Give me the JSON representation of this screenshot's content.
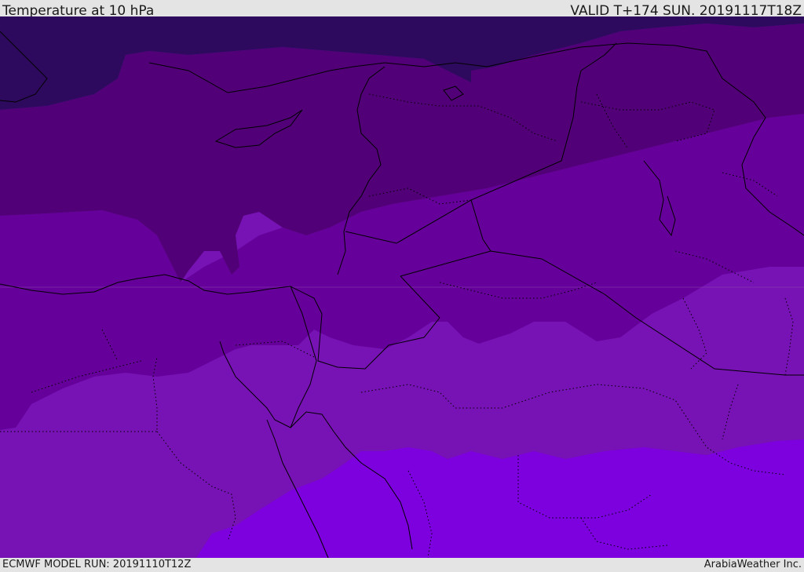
{
  "header": {
    "title": "Temperature at 10 hPa",
    "valid": "VALID T+174 SUN. 20191117T18Z"
  },
  "footer": {
    "model_run": "ECMWF MODEL RUN: 20191110T12Z",
    "credit": "ArabiaWeather Inc."
  },
  "map": {
    "field_colors": [
      "#2e0a5e",
      "#520078",
      "#66009a",
      "#7712b4",
      "#7d00df"
    ],
    "border_color": "#000000"
  }
}
